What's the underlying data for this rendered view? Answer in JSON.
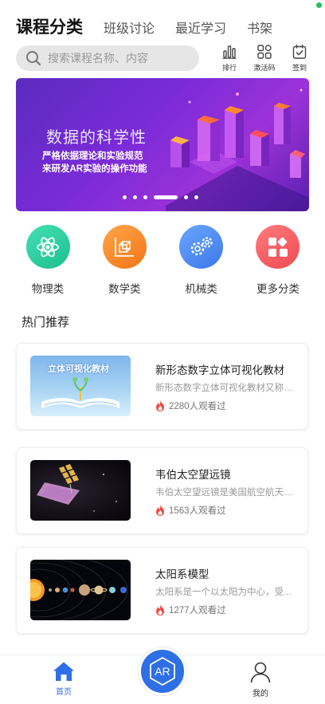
{
  "tabs": [
    {
      "label": "课程分类",
      "active": true
    },
    {
      "label": "班级讨论",
      "active": false
    },
    {
      "label": "最近学习",
      "active": false
    },
    {
      "label": "书架",
      "active": false
    }
  ],
  "search": {
    "placeholder": "搜索课程名称、内容"
  },
  "quick_actions": [
    {
      "label": "排行",
      "icon": "bar-chart-icon"
    },
    {
      "label": "激活码",
      "icon": "grid-code-icon"
    },
    {
      "label": "签到",
      "icon": "calendar-check-icon"
    }
  ],
  "banner": {
    "title": "数据的科学性",
    "subtitle_line1": "严格依据理论和实验规范",
    "subtitle_line2": "来研发AR实验的操作功能",
    "slide_count": 6,
    "active_slide": 4
  },
  "categories": [
    {
      "label": "物理类",
      "icon": "atom-icon",
      "color": "#2fd0a0"
    },
    {
      "label": "数学类",
      "icon": "cube-axis-icon",
      "color": "#f78a2a"
    },
    {
      "label": "机械类",
      "icon": "gears-icon",
      "color": "#4a8cf0"
    },
    {
      "label": "更多分类",
      "icon": "apps-icon",
      "color": "#f25d60"
    }
  ],
  "section": {
    "title": "热门推荐"
  },
  "courses": [
    {
      "title": "新形态数字立体可视化教材",
      "desc": "新形态数字立体可视化教材又称为...",
      "views": "2280人观看过",
      "thumb_text": "立体可视化教材"
    },
    {
      "title": "韦伯太空望远镜",
      "desc": "韦伯太空望远镜是美国航空航天局...",
      "views": "1563人观看过",
      "thumb_text": ""
    },
    {
      "title": "太阳系模型",
      "desc": "太阳系是一个以太阳为中心，受...",
      "views": "1277人观看过",
      "thumb_text": ""
    }
  ],
  "bottom_nav": {
    "home_label": "首页",
    "ar_label": "AR",
    "profile_label": "我的",
    "active_color": "#2f6fe6"
  }
}
